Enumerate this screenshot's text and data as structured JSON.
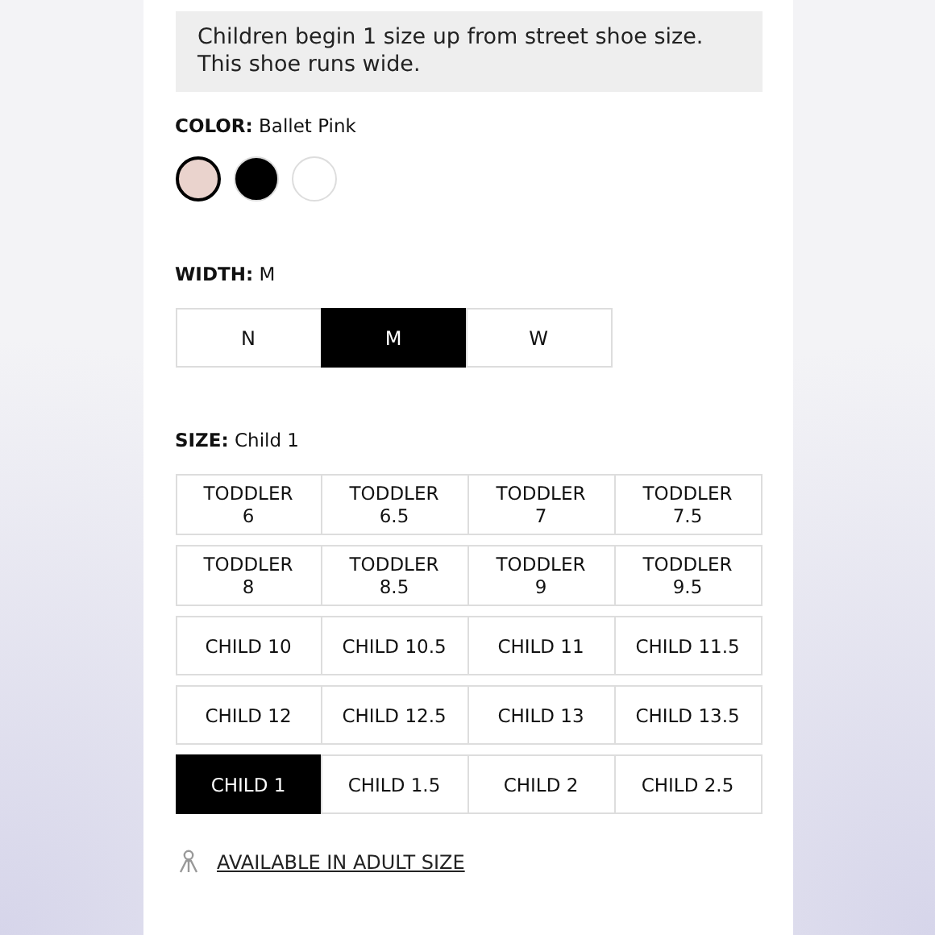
{
  "note": "Children begin 1 size up from street shoe size.\nThis shoe runs wide.",
  "color": {
    "label": "COLOR:",
    "value": "Ballet Pink",
    "swatches": [
      {
        "color": "#ead3cd",
        "selected": true
      },
      {
        "color": "#000000",
        "selected": false
      },
      {
        "color": "#ffffff",
        "selected": false
      }
    ]
  },
  "width": {
    "label": "WIDTH:",
    "value": "M",
    "options": [
      {
        "label": "N",
        "selected": false
      },
      {
        "label": "M",
        "selected": true
      },
      {
        "label": "W",
        "selected": false
      }
    ]
  },
  "size": {
    "label": "SIZE:",
    "value": "Child 1",
    "options": [
      {
        "label": "TODDLER\n6",
        "selected": false
      },
      {
        "label": "TODDLER\n6.5",
        "selected": false
      },
      {
        "label": "TODDLER\n7",
        "selected": false
      },
      {
        "label": "TODDLER\n7.5",
        "selected": false
      },
      {
        "label": "TODDLER\n8",
        "selected": false
      },
      {
        "label": "TODDLER\n8.5",
        "selected": false
      },
      {
        "label": "TODDLER\n9",
        "selected": false
      },
      {
        "label": "TODDLER\n9.5",
        "selected": false
      },
      {
        "label": "CHILD 10",
        "selected": false
      },
      {
        "label": "CHILD 10.5",
        "selected": false
      },
      {
        "label": "CHILD 11",
        "selected": false
      },
      {
        "label": "CHILD 11.5",
        "selected": false
      },
      {
        "label": "CHILD 12",
        "selected": false
      },
      {
        "label": "CHILD 12.5",
        "selected": false
      },
      {
        "label": "CHILD 13",
        "selected": false
      },
      {
        "label": "CHILD 13.5",
        "selected": false
      },
      {
        "label": "CHILD 1",
        "selected": true
      },
      {
        "label": "CHILD 1.5",
        "selected": false
      },
      {
        "label": "CHILD 2",
        "selected": false
      },
      {
        "label": "CHILD 2.5",
        "selected": false
      }
    ]
  },
  "adult_link": "AVAILABLE IN ADULT SIZE"
}
